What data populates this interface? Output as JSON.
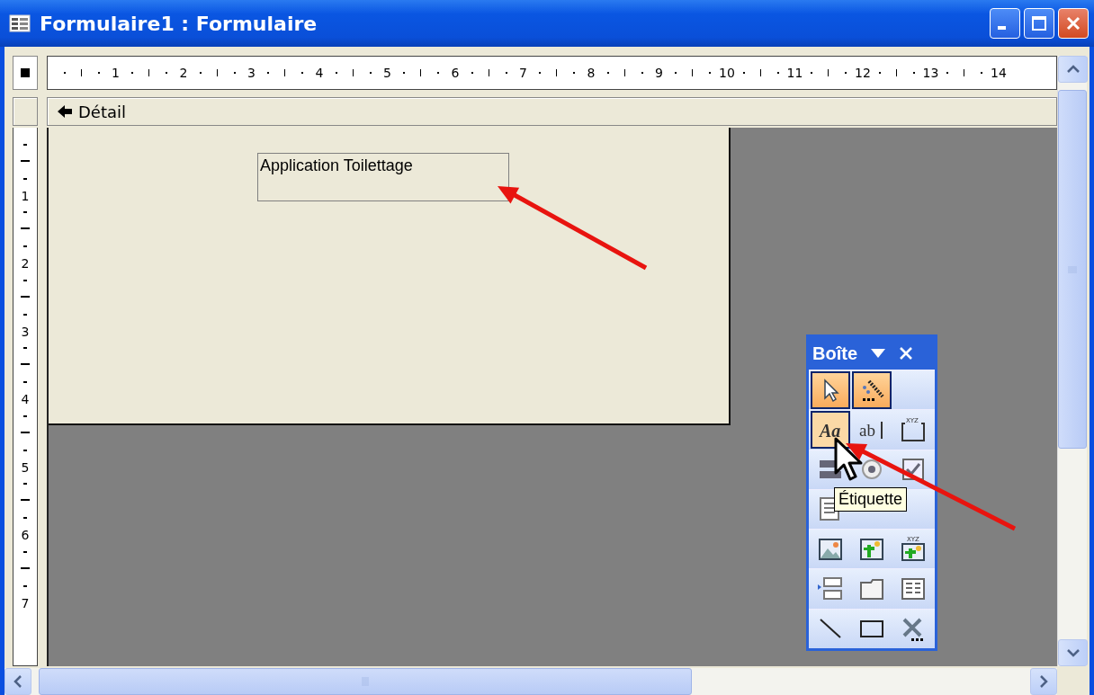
{
  "window": {
    "title": "Formulaire1 : Formulaire"
  },
  "ruler": {
    "horizontal": [
      "1",
      "2",
      "3",
      "4",
      "5",
      "6",
      "7",
      "8",
      "9",
      "10",
      "11",
      "12",
      "13",
      "14"
    ],
    "vertical": [
      "1",
      "2",
      "3",
      "4",
      "5",
      "6",
      "7"
    ]
  },
  "section": {
    "title": "Détail"
  },
  "label_control": {
    "text": "Application Toilettage"
  },
  "toolbox": {
    "title": "Boîte",
    "rows": [
      {
        "tools": [
          {
            "kind": "pointer",
            "pressed": true,
            "hovered": false
          },
          {
            "kind": "wizard",
            "pressed": true,
            "hovered": false
          }
        ]
      },
      {
        "tools": [
          {
            "kind": "label",
            "glyph": "Aa",
            "pressed": false,
            "hovered": true
          },
          {
            "kind": "textbox",
            "glyph": "ab",
            "pressed": false,
            "hovered": false
          },
          {
            "kind": "group",
            "glyph": "XYZ",
            "pressed": false,
            "hovered": false
          }
        ]
      },
      {
        "tools": [
          {
            "kind": "toggle",
            "pressed": false,
            "hovered": false
          },
          {
            "kind": "option",
            "pressed": false,
            "hovered": false
          },
          {
            "kind": "checkbox",
            "pressed": false,
            "hovered": false
          }
        ]
      },
      {
        "tools": [
          {
            "kind": "list",
            "pressed": false,
            "hovered": false
          }
        ]
      },
      {
        "tools": [
          {
            "kind": "image",
            "pressed": false,
            "hovered": false
          },
          {
            "kind": "unbound",
            "pressed": false,
            "hovered": false
          },
          {
            "kind": "bound",
            "glyph": "XYZ",
            "pressed": false,
            "hovered": false
          }
        ]
      },
      {
        "tools": [
          {
            "kind": "pagebreak",
            "pressed": false,
            "hovered": false
          },
          {
            "kind": "tab",
            "pressed": false,
            "hovered": false
          },
          {
            "kind": "subform",
            "pressed": false,
            "hovered": false
          }
        ]
      },
      {
        "tools": [
          {
            "kind": "line",
            "pressed": false,
            "hovered": false
          },
          {
            "kind": "rectangle",
            "pressed": false,
            "hovered": false
          },
          {
            "kind": "more",
            "pressed": false,
            "hovered": false
          }
        ]
      }
    ]
  },
  "tooltip": {
    "text": "Étiquette"
  }
}
